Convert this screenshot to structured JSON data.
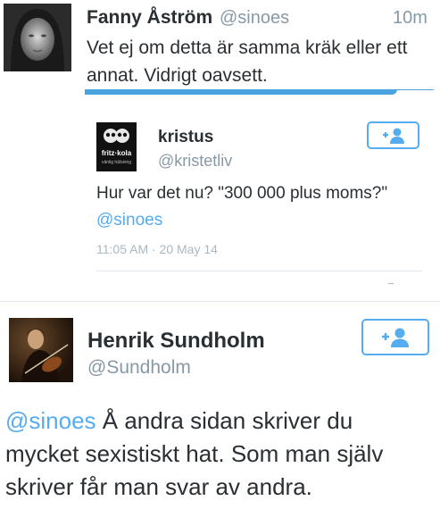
{
  "tweet1": {
    "author_name": "Fanny Åström",
    "author_handle": "@sinoes",
    "time": "10m",
    "text_line1": "Vet ej om detta är samma kräk eller ett",
    "text_line2": "annat. Vidrigt oavsett."
  },
  "embedded": {
    "author_name": "kristus",
    "author_handle": "@kristetliv",
    "avatar_text": "fritz·kola",
    "avatar_subtext": "vänlig hälsning",
    "text": "Hur var det nu? \"300 000 plus moms?\"",
    "mention": "@sinoes",
    "timestamp": "11:05 AM · 20 May 14"
  },
  "tweet2": {
    "author_name": "Henrik Sundholm",
    "author_handle": "@Sundholm",
    "mention": "@sinoes",
    "text_line1": " Å andra sidan skriver du",
    "text_line2": "mycket sexistiskt hat. Som man själv",
    "text_line3": "skriver får man svar av andra."
  },
  "colors": {
    "accent": "#55acee",
    "muted": "#8899a6",
    "text": "#292f33",
    "divider": "#e1e8ed"
  },
  "icons": [
    "follow-user-icon"
  ]
}
